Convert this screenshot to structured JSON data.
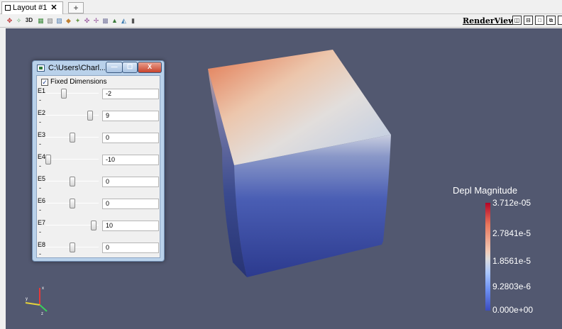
{
  "tab": {
    "label": "Layout #1",
    "close": "✕",
    "add": "+"
  },
  "toolbar": {
    "mode_3d": "3D",
    "render_view": "RenderView1"
  },
  "dialog": {
    "title": "C:\\Users\\Charl...",
    "min": "—",
    "max": "☐",
    "close": "X",
    "fixed_dimensions_label": "Fixed Dimensions",
    "fixed_dimensions_checked": true,
    "params": [
      {
        "label": "E1",
        "dash": "-",
        "value": "-2",
        "slider_fraction": 0.33
      },
      {
        "label": "E2",
        "dash": "-",
        "value": "9",
        "slider_fraction": 0.88
      },
      {
        "label": "E3",
        "dash": "-",
        "value": "0",
        "slider_fraction": 0.5
      },
      {
        "label": "E4",
        "dash": "-",
        "value": "-10",
        "slider_fraction": 0.0
      },
      {
        "label": "E5",
        "dash": "-",
        "value": "0",
        "slider_fraction": 0.5
      },
      {
        "label": "E6",
        "dash": "-",
        "value": "0",
        "slider_fraction": 0.5
      },
      {
        "label": "E7",
        "dash": "-",
        "value": "10",
        "slider_fraction": 0.96
      },
      {
        "label": "E8",
        "dash": "-",
        "value": "0",
        "slider_fraction": 0.5
      }
    ]
  },
  "scalar_bar": {
    "title": "Depl Magnitude",
    "labels": [
      "3.712e-05",
      "2.7841e-5",
      "1.8561e-5",
      "9.2803e-6",
      "0.000e+00"
    ]
  },
  "axes": {
    "x": "x",
    "y": "y",
    "z": "z"
  },
  "colors": {
    "background": "#525870",
    "cube_top": "#d9dce6",
    "cube_front": "#3a4fa8",
    "accent_hot": "#b40426",
    "accent_cold": "#3b4cc0"
  }
}
